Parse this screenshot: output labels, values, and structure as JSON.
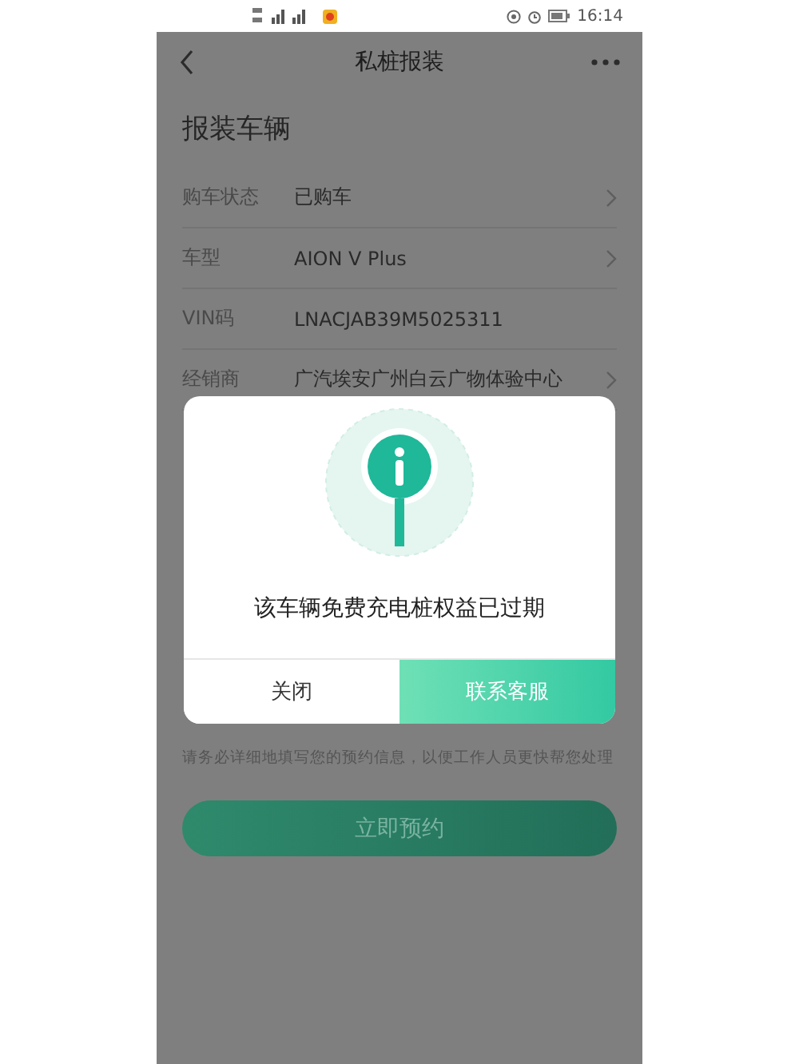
{
  "status_bar": {
    "time": "16:14"
  },
  "header": {
    "title": "私桩报装"
  },
  "section_title": "报装车辆",
  "fields": [
    {
      "label": "购车状态",
      "value": "已购车",
      "has_arrow": true
    },
    {
      "label": "车型",
      "value": "AION V Plus",
      "has_arrow": true
    },
    {
      "label": "VIN码",
      "value": "LNACJAB39M5025311",
      "has_arrow": false
    },
    {
      "label": "经销商",
      "value": "广汽埃安广州白云广物体验中心",
      "has_arrow": true
    }
  ],
  "note": "请务必详细地填写您的预约信息，以便工作人员更快帮您处理",
  "submit_button": "立即预约",
  "dialog": {
    "message": "该车辆免费充电桩权益已过期",
    "buttons": [
      {
        "label": "关闭",
        "kind": "secondary"
      },
      {
        "label": "联系客服",
        "kind": "primary"
      }
    ]
  }
}
